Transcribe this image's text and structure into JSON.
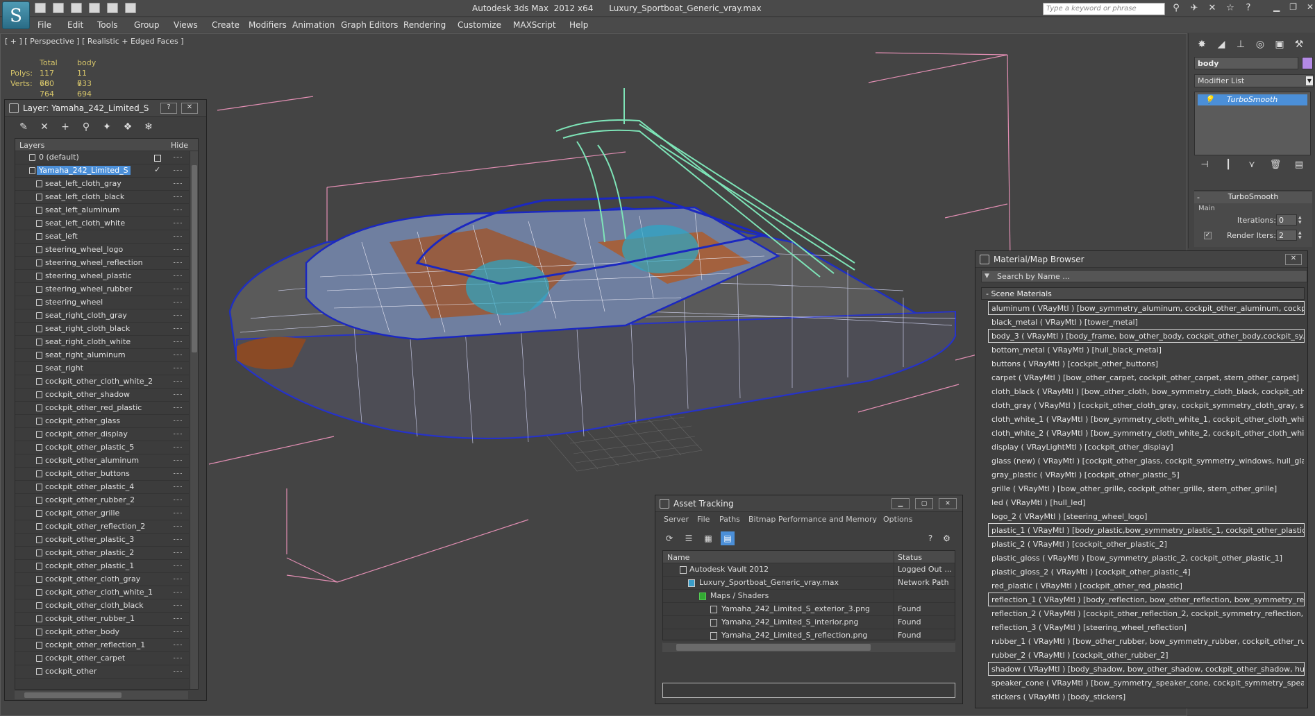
{
  "app": {
    "logo": "S",
    "title": "Autodesk 3ds Max  2012 x64      Luxury_Sportboat_Generic_vray.max",
    "search_placeholder": "Type a keyword or phrase"
  },
  "menu": [
    "File",
    "Edit",
    "Tools",
    "Group",
    "Views",
    "Create",
    "Modifiers",
    "Animation",
    "Graph Editors",
    "Rendering",
    "Customize",
    "MAXScript",
    "Help"
  ],
  "viewport": {
    "label": "[ + ] [ Perspective ] [ Realistic + Edged Faces ]",
    "stats": {
      "col_total": "Total",
      "col_body": "body",
      "polys_label": "Polys:",
      "polys_total": "117 760",
      "polys_body": "11 733",
      "verts_label": "Verts:",
      "verts_total": "68 764",
      "verts_body": "6 694"
    }
  },
  "command_panel": {
    "object_name": "body",
    "object_color": "#b48ae6",
    "modifier_list": "Modifier List",
    "stack_item": "TurboSmooth",
    "rollout_title": "TurboSmooth",
    "main_label": "Main",
    "iterations_label": "Iterations:",
    "iterations_value": "0",
    "render_iters_label": "Render Iters:",
    "render_iters_value": "2"
  },
  "layer_panel": {
    "title": "Layer: Yamaha_242_Limited_S",
    "help": "?",
    "close": "✕",
    "col_layers": "Layers",
    "col_hide": "Hide",
    "default_layer": "0 (default)",
    "active_layer": "Yamaha_242_Limited_S",
    "items": [
      "seat_left_cloth_gray",
      "seat_left_cloth_black",
      "seat_left_aluminum",
      "seat_left_cloth_white",
      "seat_left",
      "steering_wheel_logo",
      "steering_wheel_reflection",
      "steering_wheel_plastic",
      "steering_wheel_rubber",
      "steering_wheel",
      "seat_right_cloth_gray",
      "seat_right_cloth_black",
      "seat_right_cloth_white",
      "seat_right_aluminum",
      "seat_right",
      "cockpit_other_cloth_white_2",
      "cockpit_other_shadow",
      "cockpit_other_red_plastic",
      "cockpit_other_glass",
      "cockpit_other_display",
      "cockpit_other_plastic_5",
      "cockpit_other_aluminum",
      "cockpit_other_buttons",
      "cockpit_other_plastic_4",
      "cockpit_other_rubber_2",
      "cockpit_other_grille",
      "cockpit_other_reflection_2",
      "cockpit_other_plastic_3",
      "cockpit_other_plastic_2",
      "cockpit_other_plastic_1",
      "cockpit_other_cloth_gray",
      "cockpit_other_cloth_white_1",
      "cockpit_other_cloth_black",
      "cockpit_other_rubber_1",
      "cockpit_other_body",
      "cockpit_other_reflection_1",
      "cockpit_other_carpet",
      "cockpit_other"
    ]
  },
  "asset_tracking": {
    "title": "Asset Tracking",
    "menu": [
      "Server",
      "File",
      "Paths",
      "Bitmap Performance and Memory",
      "Options"
    ],
    "col_name": "Name",
    "col_status": "Status",
    "rows": [
      {
        "name": "Autodesk Vault 2012",
        "status": "Logged Out ..."
      },
      {
        "name": "Luxury_Sportboat_Generic_vray.max",
        "status": "Network Path"
      },
      {
        "name": "Maps / Shaders",
        "status": ""
      },
      {
        "name": "Yamaha_242_Limited_S_exterior_3.png",
        "status": "Found"
      },
      {
        "name": "Yamaha_242_Limited_S_interior.png",
        "status": "Found"
      },
      {
        "name": "Yamaha_242_Limited_S_reflection.png",
        "status": "Found"
      }
    ]
  },
  "material_browser": {
    "title": "Material/Map Browser",
    "search": "Search by Name ...",
    "group": "- Scene Materials",
    "items": [
      "aluminum  ( VRayMtl ) [bow_symmetry_aluminum, cockpit_other_aluminum, cockpi...",
      "black_metal  ( VRayMtl ) [tower_metal]",
      "body_3 ( VRayMtl ) [body_frame, bow_other_body, cockpit_other_body,cockpit_sy...",
      "bottom_metal  ( VRayMtl ) [hull_black_metal]",
      "buttons  ( VRayMtl ) [cockpit_other_buttons]",
      "carpet  ( VRayMtl ) [bow_other_carpet, cockpit_other_carpet, stern_other_carpet]",
      "cloth_black  ( VRayMtl ) [bow_other_cloth, bow_symmetry_cloth_black, cockpit_oth...",
      "cloth_gray  ( VRayMtl ) [cockpit_other_cloth_gray, cockpit_symmetry_cloth_gray, se...",
      "cloth_white_1  ( VRayMtl ) [bow_symmetry_cloth_white_1, cockpit_other_cloth_whi...",
      "cloth_white_2  ( VRayMtl ) [bow_symmetry_cloth_white_2, cockpit_other_cloth_whi...",
      "display  ( VRayLightMtl ) [cockpit_other_display]",
      "glass (new)  ( VRayMtl ) [cockpit_other_glass, cockpit_symmetry_windows, hull_gla...",
      "gray_plastic  ( VRayMtl ) [cockpit_other_plastic_5]",
      "grille  ( VRayMtl ) [bow_other_grille, cockpit_other_grille, stern_other_grille]",
      "led  ( VRayMtl ) [hull_led]",
      "logo_2  ( VRayMtl ) [steering_wheel_logo]",
      "plastic_1  ( VRayMtl ) [body_plastic,bow_symmetry_plastic_1, cockpit_other_plastic...",
      "plastic_2  ( VRayMtl ) [cockpit_other_plastic_2]",
      "plastic_gloss  ( VRayMtl ) [bow_symmetry_plastic_2, cockpit_other_plastic_1]",
      "plastic_gloss_2  ( VRayMtl ) [cockpit_other_plastic_4]",
      "red_plastic  ( VRayMtl ) [cockpit_other_red_plastic]",
      "reflection_1  ( VRayMtl ) [body_reflection, bow_other_reflection, bow_symmetry_ref...",
      "reflection_2  ( VRayMtl ) [cockpit_other_reflection_2, cockpit_symmetry_reflection,...",
      "reflection_3  ( VRayMtl ) [steering_wheel_reflection]",
      "rubber_1  ( VRayMtl ) [bow_other_rubber, bow_symmetry_rubber, cockpit_other_ru...",
      "rubber_2  ( VRayMtl ) [cockpit_other_rubber_2]",
      "shadow  ( VRayMtl ) [body_shadow, bow_other_shadow, cockpit_other_shadow, hu...",
      "speaker_cone  ( VRayMtl ) [bow_symmetry_speaker_cone, cockpit_symmetry_spea...",
      "stickers  ( VRayMtl ) [body_stickers]"
    ]
  }
}
